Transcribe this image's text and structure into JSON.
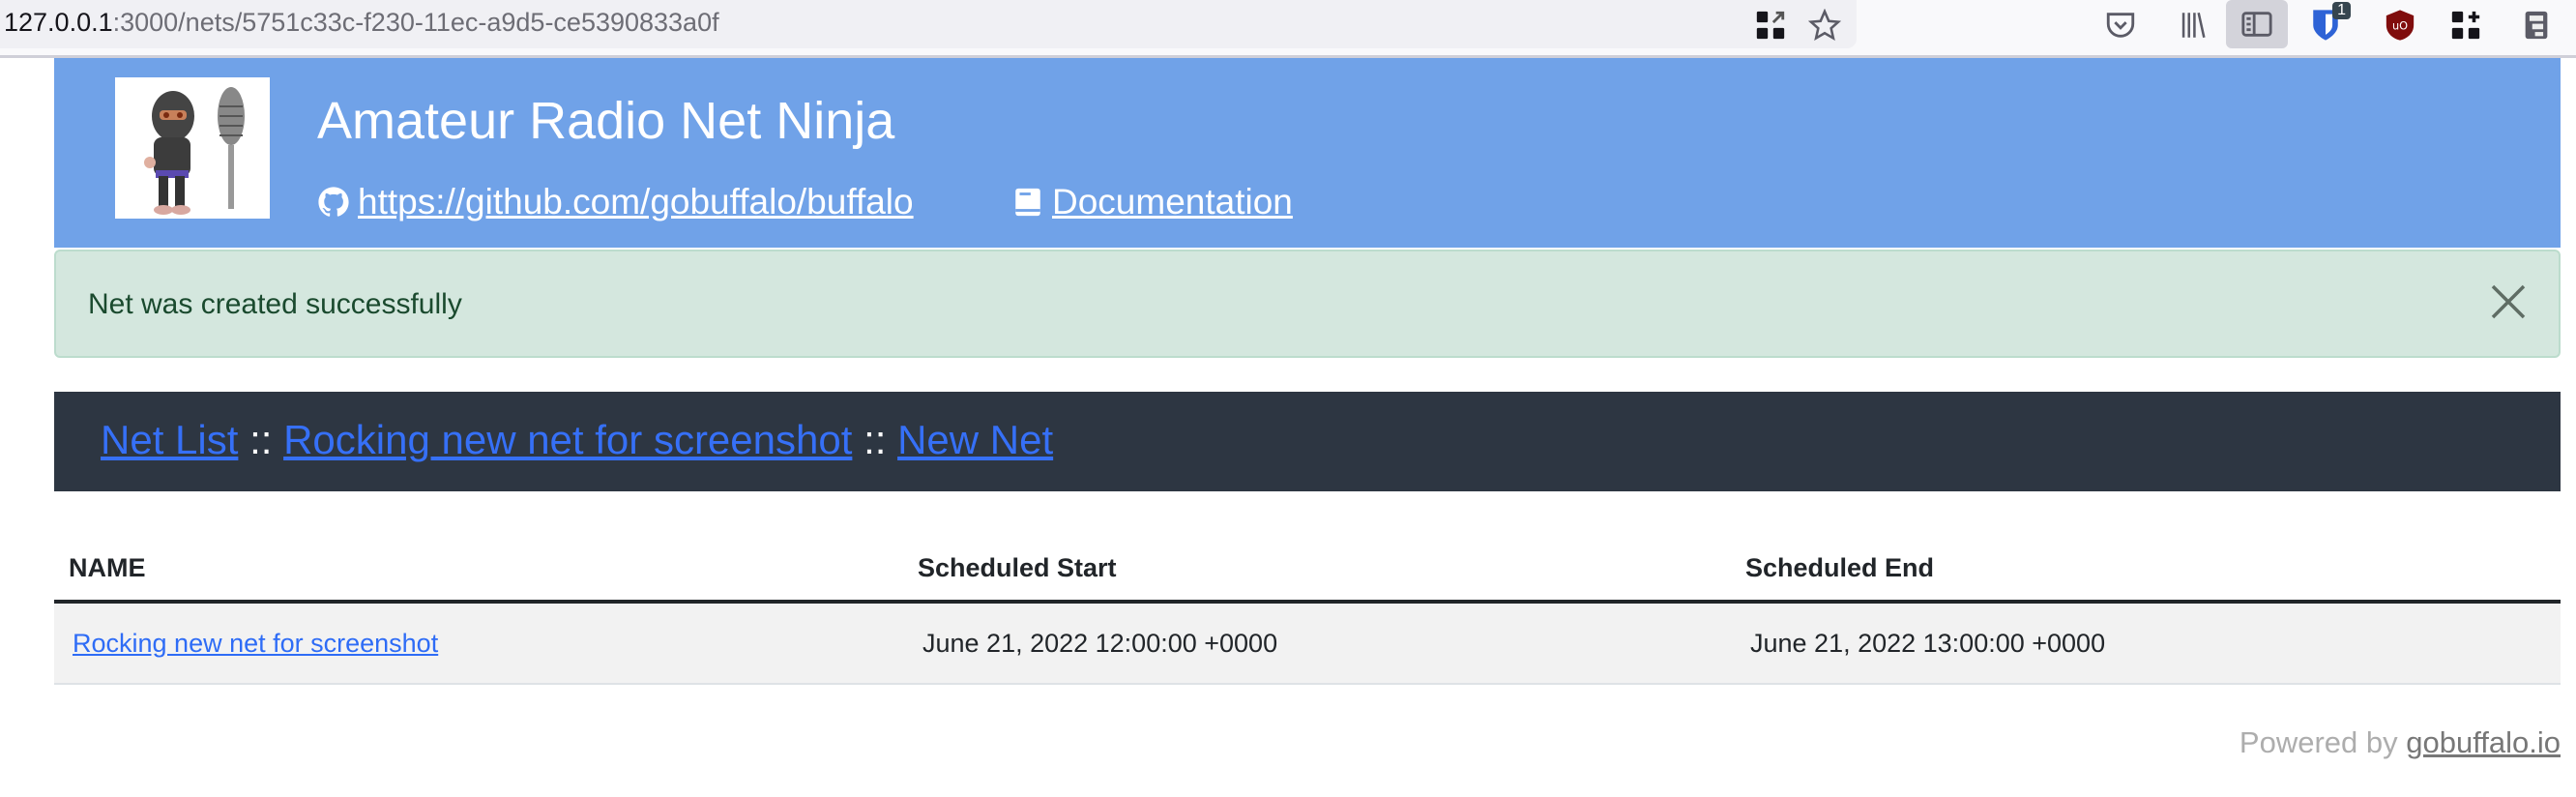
{
  "browser": {
    "url_host": "127.0.0.1",
    "url_rest": ":3000/nets/5751c33c-f230-11ec-a9d5-ce5390833a0f",
    "icons": [
      "qr-code-icon",
      "bookmark-star-icon",
      "pocket-icon",
      "library-icon",
      "sidebar-icon",
      "bitwarden-icon",
      "ublock-icon",
      "extensions-icon",
      "container-icon"
    ],
    "bitwarden_badge": "1"
  },
  "header": {
    "title": "Amateur Radio Net Ninja",
    "github_link": "https://github.com/gobuffalo/buffalo",
    "docs_link": "Documentation",
    "color": "#70a2e8"
  },
  "alert": {
    "message": "Net was created successfully",
    "close": "×"
  },
  "breadcrumb": {
    "items": [
      "Net List",
      "Rocking new net for screenshot",
      "New Net"
    ],
    "separator": "::"
  },
  "table": {
    "columns": [
      "NAME",
      "Scheduled Start",
      "Scheduled End"
    ],
    "rows": [
      {
        "name": "Rocking new net for screenshot",
        "start": "June 21, 2022 12:00:00 +0000",
        "end": "June 21, 2022 13:00:00 +0000"
      }
    ]
  },
  "footer": {
    "prefix": "Powered by",
    "link": "gobuffalo.io"
  }
}
